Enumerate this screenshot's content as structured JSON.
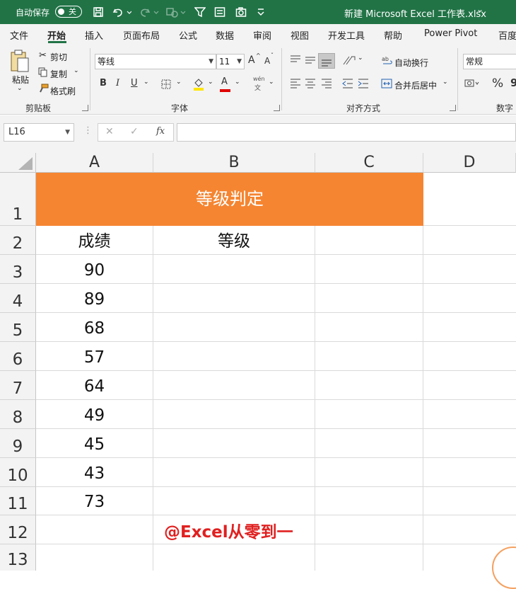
{
  "titlebar": {
    "autosave_label": "自动保存",
    "autosave_state": "关",
    "doc_title": "新建 Microsoft Excel 工作表.xlsx",
    "title_chevron": "⌄"
  },
  "menu": {
    "items": [
      "文件",
      "开始",
      "插入",
      "页面布局",
      "公式",
      "数据",
      "审阅",
      "视图",
      "开发工具",
      "帮助",
      "Power Pivot",
      "百度"
    ],
    "active": "开始"
  },
  "ribbon": {
    "clipboard": {
      "paste": "粘贴",
      "cut": "剪切",
      "copy": "复制",
      "format_painter": "格式刷",
      "group_label": "剪贴板"
    },
    "font": {
      "font_name": "等线",
      "font_size": "11",
      "grow": "A",
      "shrink": "A",
      "bold": "B",
      "italic": "I",
      "underline": "U",
      "font_color_letter": "A",
      "phonetic_top": "wén",
      "phonetic_bottom": "文",
      "group_label": "字体"
    },
    "alignment": {
      "wrap_text": "自动换行",
      "merge_center": "合并后居中",
      "group_label": "对齐方式"
    },
    "number": {
      "format": "常规",
      "percent": "%",
      "comma": "9",
      "group_label": "数字"
    },
    "colors": {
      "fill": "#ffe600",
      "font_color": "#e00000"
    }
  },
  "formula_bar": {
    "name_box": "L16",
    "fx": "fx",
    "value": ""
  },
  "sheet": {
    "columns": [
      "A",
      "B",
      "C",
      "D"
    ],
    "rows": [
      "1",
      "2",
      "3",
      "4",
      "5",
      "6",
      "7",
      "8",
      "9",
      "10",
      "11",
      "12",
      "13"
    ],
    "title": "等级判定",
    "header_score": "成绩",
    "header_grade": "等级",
    "scores": [
      "90",
      "89",
      "68",
      "57",
      "64",
      "49",
      "45",
      "43",
      "73"
    ],
    "title_fill": "#f58531"
  },
  "watermark": "@Excel从零到一"
}
